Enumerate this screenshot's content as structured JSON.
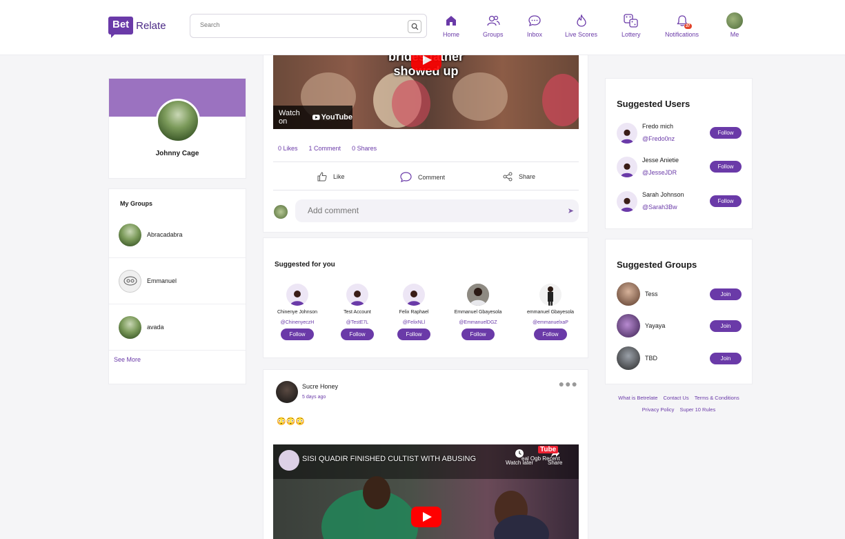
{
  "header": {
    "logo_bet": "Bet",
    "logo_relate": "Relate",
    "search_placeholder": "Search",
    "nav": [
      {
        "label": "Home",
        "icon": "home-icon"
      },
      {
        "label": "Groups",
        "icon": "groups-icon"
      },
      {
        "label": "Inbox",
        "icon": "inbox-icon"
      },
      {
        "label": "Live Scores",
        "icon": "flame-icon"
      },
      {
        "label": "Lottery",
        "icon": "dice-icon"
      },
      {
        "label": "Notifications",
        "icon": "bell-icon",
        "badge": "37"
      },
      {
        "label": "Me",
        "icon": "avatar"
      }
    ]
  },
  "profile": {
    "name": "Johnny Cage"
  },
  "my_groups": {
    "title": "My Groups",
    "items": [
      {
        "name": "Abracadabra"
      },
      {
        "name": "Emmanuel"
      },
      {
        "name": "avada"
      }
    ],
    "see_more": "See More"
  },
  "post1": {
    "video_caption_top": "brides father",
    "video_caption_bottom": "showed up",
    "watch_on": "Watch on",
    "youtube": "YouTube",
    "likes": "0 Likes",
    "comments": "1 Comment",
    "shares": "0 Shares",
    "like_label": "Like",
    "comment_label": "Comment",
    "share_label": "Share",
    "comment_placeholder": "Add comment"
  },
  "suggested_for_you": {
    "title": "Suggested for you",
    "people": [
      {
        "name": "Chinenye Johnson",
        "handle": "@ChinenyeczH",
        "button": "Follow",
        "photo": false
      },
      {
        "name": "Test Account",
        "handle": "@TestE7L",
        "button": "Follow",
        "photo": false
      },
      {
        "name": "Felix Raphael",
        "handle": "@FelixNLl",
        "button": "Follow",
        "photo": false
      },
      {
        "name": "Emmanuel Gbayesola",
        "handle": "@EmmanuelDGZ",
        "button": "Follow",
        "photo": true
      },
      {
        "name": "emmanuel Gbayesola",
        "handle": "@emmanuelxaP",
        "button": "Follow",
        "photo": true
      }
    ]
  },
  "post2": {
    "author": "Sucre Honey",
    "time": "5 days ago",
    "text": "😳😳😳",
    "video_title": "SISI QUADIR FINISHED CULTIST WITH ABUSING",
    "watch_later": "Watch later",
    "share": "Share",
    "channel_overlay": "Tube",
    "overlay_sub": "eal Ogb Recent"
  },
  "suggested_users": {
    "title": "Suggested Users",
    "users": [
      {
        "name": "Fredo mich",
        "handle": "@Fredo0nz",
        "button": "Follow"
      },
      {
        "name": "Jesse Anietie",
        "handle": "@JesseJDR",
        "button": "Follow"
      },
      {
        "name": "Sarah Johnson",
        "handle": "@Sarah3Bw",
        "button": "Follow"
      }
    ]
  },
  "suggested_groups": {
    "title": "Suggested Groups",
    "groups": [
      {
        "name": "Tess",
        "button": "Join",
        "color": "#8a6a5a"
      },
      {
        "name": "Yayaya",
        "button": "Join",
        "color": "#5a3a6a"
      },
      {
        "name": "TBD",
        "button": "Join",
        "color": "#4a4a4a"
      }
    ]
  },
  "footer": {
    "links_row1": [
      "What is Betrelate",
      "Contact Us",
      "Terms & Conditions"
    ],
    "links_row2": [
      "Privacy Policy",
      "Super 10 Rules"
    ]
  },
  "colors": {
    "accent": "#6a3aa8",
    "banner": "#9b72c0",
    "badge": "#e2432a"
  }
}
